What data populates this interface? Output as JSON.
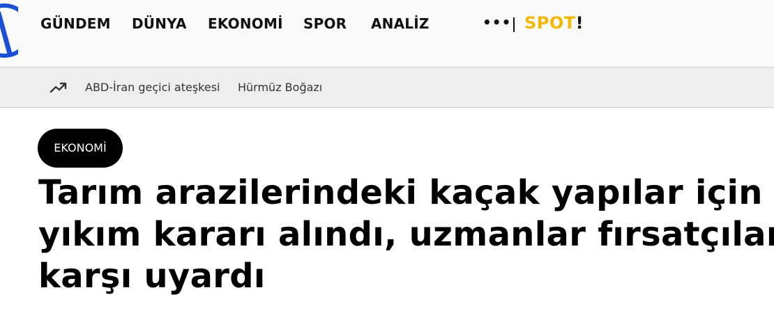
{
  "header": {
    "logo_text": "AA",
    "nav": [
      "GÜNDEM",
      "DÜNYA",
      "EKONOMİ",
      "SPOR",
      "ANALİZ"
    ],
    "more_icon": "ellipsis-icon",
    "spot_logo": {
      "text": "SPOT",
      "bang": "!"
    }
  },
  "trending": {
    "icon": "trending-up-icon",
    "links": [
      "ABD-İran geçici ateşkesi",
      "Hürmüz Boğazı"
    ]
  },
  "article": {
    "category": "EKONOMİ",
    "title_lines": [
      "Tarım arazilerindeki kaçak yapılar için",
      "yıkım kararı alındı, uzmanlar fırsatçılara",
      "karşı uyardı"
    ]
  },
  "colors": {
    "brand_blue": "#1a4fd6",
    "spot_yellow": "#f5b700",
    "topbar_bg": "#fafafa",
    "trendbar_bg": "#eeeeee",
    "pill_bg": "#000000"
  }
}
